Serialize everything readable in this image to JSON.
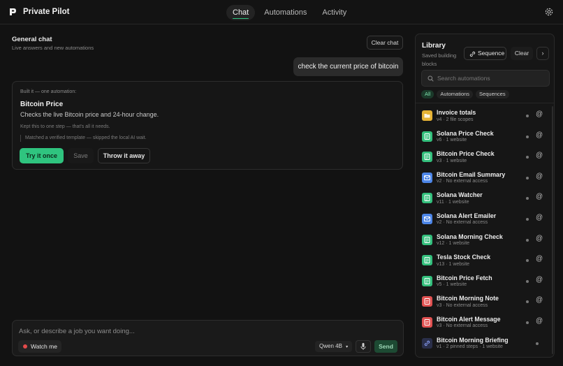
{
  "app": {
    "title": "Private Pilot"
  },
  "nav": {
    "tabs": [
      {
        "label": "Chat"
      },
      {
        "label": "Automations"
      },
      {
        "label": "Activity"
      }
    ],
    "active": "Chat"
  },
  "chat": {
    "title": "General chat",
    "subtitle": "Live answers and new automations",
    "clear_label": "Clear chat",
    "user_message": "check the current price of bitcoin",
    "result": {
      "built_label": "Built it — one automation:",
      "name": "Bitcoin Price",
      "description": "Checks the live Bitcoin price and 24-hour change.",
      "note1": "Kept this to one step — that's all it needs.",
      "note2": "Matched a verified template — skipped the local AI wait.",
      "try_label": "Try it once",
      "save_label": "Save",
      "throw_label": "Throw it away"
    }
  },
  "composer": {
    "placeholder": "Ask, or describe a job you want doing...",
    "watch_label": "Watch me",
    "model": "Qwen 4B",
    "send_label": "Send"
  },
  "library": {
    "title": "Library",
    "subtitle": "Saved building blocks",
    "sequence_label": "Sequence",
    "clear_label": "Clear",
    "search_placeholder": "Search automations",
    "filters": [
      {
        "label": "All"
      },
      {
        "label": "Automations"
      },
      {
        "label": "Sequences"
      }
    ],
    "items": [
      {
        "name": "Invoice totals",
        "meta": "v4 · 2 file scopes",
        "color": "#e6b335",
        "icon": "folder-icon"
      },
      {
        "name": "Solana Price Check",
        "meta": "v6 · 1 website",
        "color": "#33bf7c",
        "icon": "document-icon"
      },
      {
        "name": "Bitcoin Price Check",
        "meta": "v3 · 1 website",
        "color": "#33bf7c",
        "icon": "document-icon"
      },
      {
        "name": "Bitcoin Email Summary",
        "meta": "v2 · No external access",
        "color": "#4d86e8",
        "icon": "mail-icon"
      },
      {
        "name": "Solana Watcher",
        "meta": "v11 · 1 website",
        "color": "#33bf7c",
        "icon": "document-icon"
      },
      {
        "name": "Solana Alert Emailer",
        "meta": "v2 · No external access",
        "color": "#4d86e8",
        "icon": "mail-icon"
      },
      {
        "name": "Solana Morning Check",
        "meta": "v12 · 1 website",
        "color": "#33bf7c",
        "icon": "document-icon"
      },
      {
        "name": "Tesla Stock Check",
        "meta": "v13 · 1 website",
        "color": "#33bf7c",
        "icon": "document-icon"
      },
      {
        "name": "Bitcoin Price Fetch",
        "meta": "v5 · 1 website",
        "color": "#33bf7c",
        "icon": "document-icon"
      },
      {
        "name": "Bitcoin Morning Note",
        "meta": "v3 · No external access",
        "color": "#e05151",
        "icon": "note-icon"
      },
      {
        "name": "Bitcoin Alert Message",
        "meta": "v3 · No external access",
        "color": "#e05151",
        "icon": "note-icon"
      },
      {
        "name": "Bitcoin Morning Briefing",
        "meta": "v1 · 2 pinned steps · 1 website",
        "color": "#2a2f4a",
        "icon": "link-icon"
      }
    ]
  }
}
